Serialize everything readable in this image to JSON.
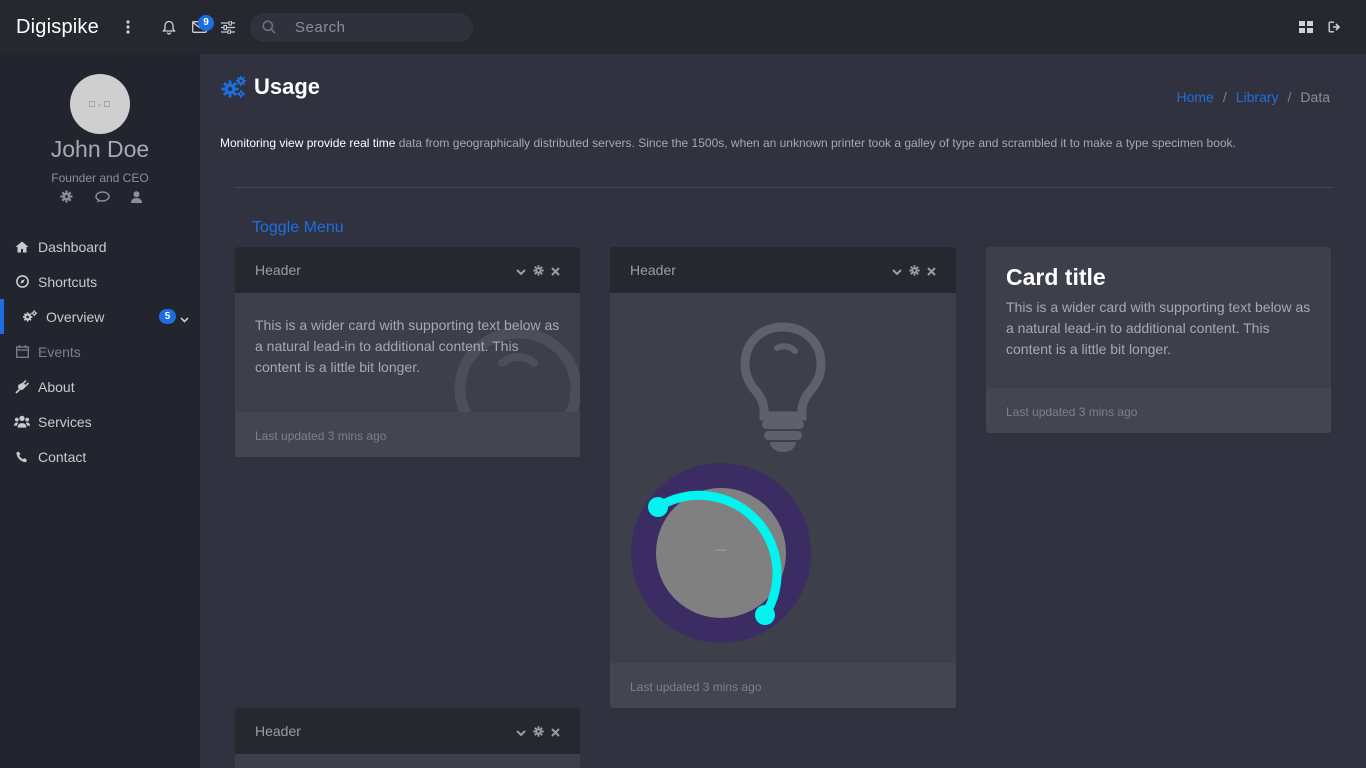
{
  "topbar": {
    "brand": "Digispike",
    "messages_badge": "9",
    "search_placeholder": "Search"
  },
  "sidebar": {
    "user_name": "John Doe",
    "user_role": "Founder and CEO",
    "items": [
      {
        "label": "Dashboard",
        "icon": "home-icon"
      },
      {
        "label": "Shortcuts",
        "icon": "compass-icon"
      },
      {
        "label": "Overview",
        "icon": "cogs-icon",
        "badge": "5",
        "active": true
      },
      {
        "label": "Events",
        "icon": "calendar-icon"
      },
      {
        "label": "About",
        "icon": "plug-icon"
      },
      {
        "label": "Services",
        "icon": "users-icon"
      },
      {
        "label": "Contact",
        "icon": "phone-icon"
      }
    ]
  },
  "main": {
    "title": "Usage",
    "breadcrumb": [
      "Home",
      "Library",
      "Data"
    ],
    "intro_bold": "Monitoring view provide real time",
    "intro_rest": " data from geographically distributed servers. Since the 1500s, when an unknown printer took a galley of type and scrambled it to make a type specimen book.",
    "toggle_menu": "Toggle Menu"
  },
  "cards": [
    {
      "header": "Header",
      "text": "This is a wider card with supporting text below as a natural lead-in to additional content. This content is a little bit longer.",
      "footer": "Last updated 3 mins ago"
    },
    {
      "header": "Header",
      "knob_value": "—",
      "footer": "Last updated 3 mins ago"
    },
    {
      "title": "Card title",
      "text": "This is a wider card with supporting text below as a natural lead-in to additional content. This content is a little bit longer.",
      "footer": "Last updated 3 mins ago"
    },
    {
      "header": "Header"
    }
  ],
  "colors": {
    "accent": "#1d6fe0",
    "knob_track": "#3b2d63",
    "knob_arc": "#00f5f0",
    "knob_face": "#808080"
  }
}
